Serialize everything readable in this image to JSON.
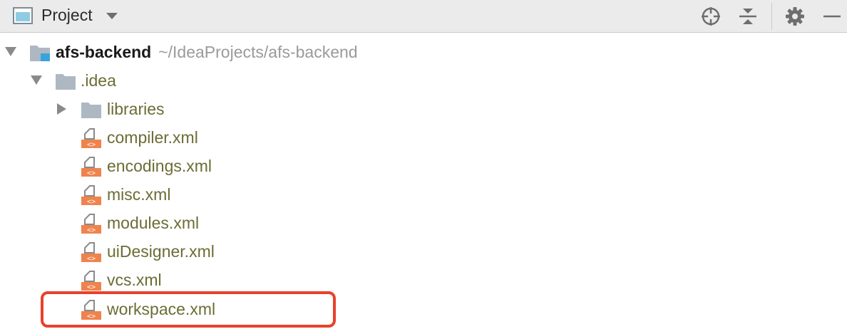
{
  "header": {
    "title": "Project"
  },
  "tree": {
    "root": {
      "name": "afs-backend",
      "path": "~/IdeaProjects/afs-backend"
    },
    "idea_folder": ".idea",
    "libraries_folder": "libraries",
    "files": [
      "compiler.xml",
      "encodings.xml",
      "misc.xml",
      "modules.xml",
      "uiDesigner.xml",
      "vcs.xml",
      "workspace.xml"
    ]
  },
  "colors": {
    "highlight": "#e8412c",
    "xml_icon": "#f0834d",
    "folder": "#aeb8c2",
    "file_text": "#6c6c35"
  }
}
